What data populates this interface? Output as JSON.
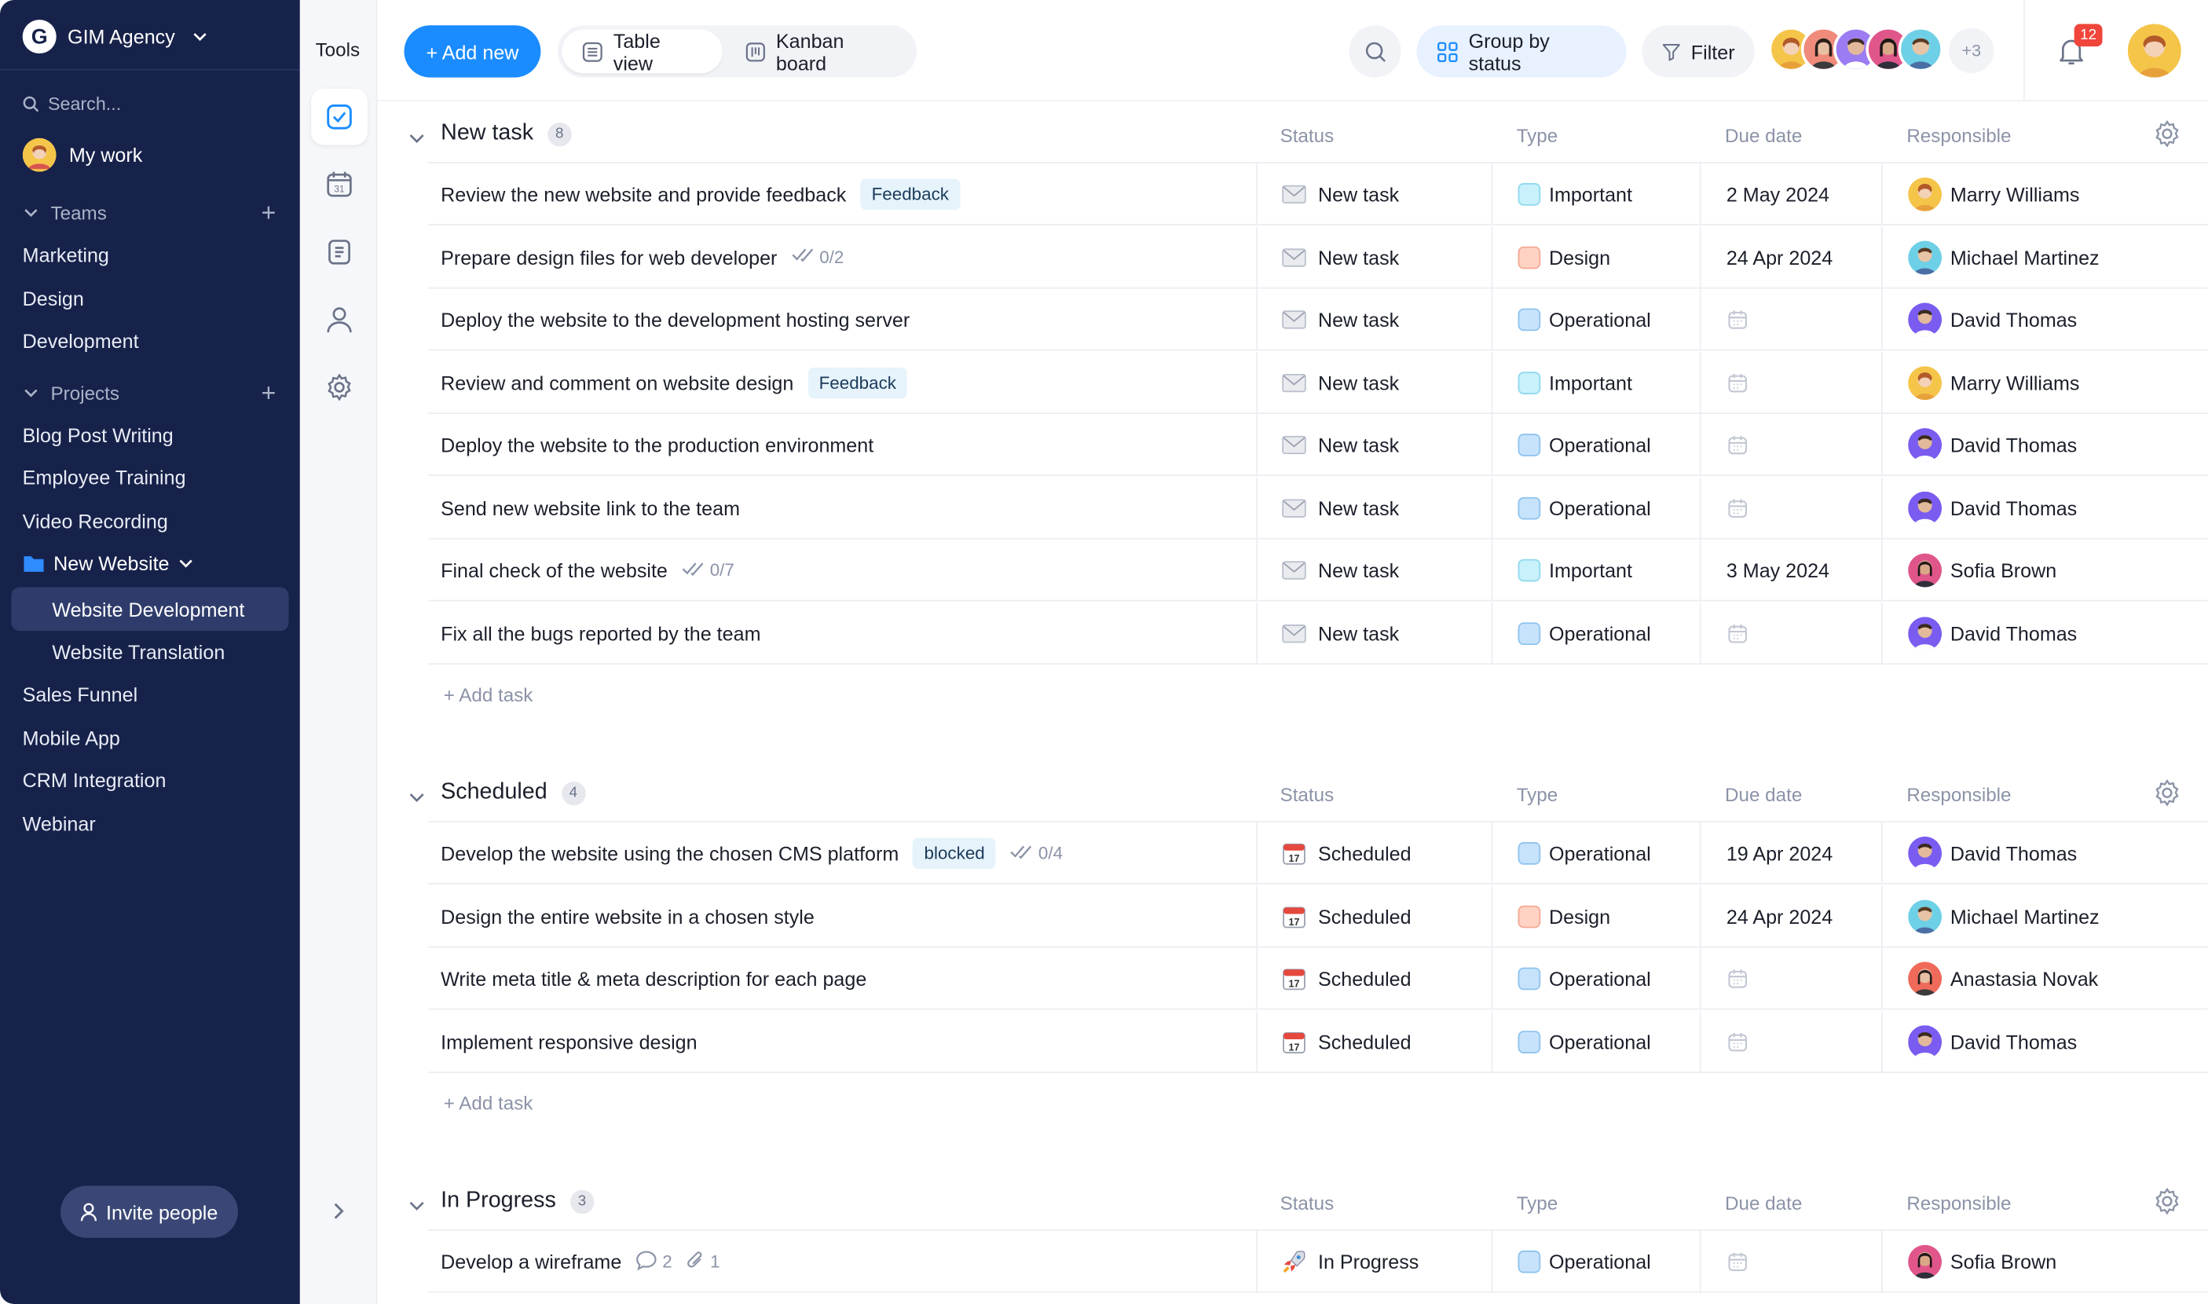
{
  "workspace": {
    "name": "GIM Agency",
    "logo_letter": "G"
  },
  "sidebar": {
    "search_placeholder": "Search...",
    "my_work": "My work",
    "teams_label": "Teams",
    "teams": [
      "Marketing",
      "Design",
      "Development"
    ],
    "projects_label": "Projects",
    "projects_top": [
      "Blog Post Writing",
      "Employee Training",
      "Video Recording"
    ],
    "folder": "New Website",
    "folder_items": [
      "Website Development",
      "Website Translation"
    ],
    "projects_bottom": [
      "Sales Funnel",
      "Mobile App",
      "CRM Integration",
      "Webinar"
    ],
    "invite_label": "Invite people"
  },
  "tools": {
    "title": "Tools"
  },
  "toolbar": {
    "add_new": "+ Add new",
    "views": [
      "Table view",
      "Kanban board"
    ],
    "group_by": "Group by status",
    "filter": "Filter",
    "more_members": "+3",
    "notifications": "12"
  },
  "columns": {
    "status": "Status",
    "type": "Type",
    "due": "Due date",
    "responsible": "Responsible"
  },
  "add_task_label": "+ Add task",
  "colors": {
    "accent": "#1a8cff",
    "sidebar": "#17224a",
    "badge": "#f0453a"
  },
  "groups": [
    {
      "title": "New task",
      "count": "8",
      "rows": [
        {
          "name": "Review the new website and provide feedback",
          "tag": "Feedback",
          "status": "New task",
          "status_icon": "envelope-icon",
          "type": "Important",
          "due": "2 May 2024",
          "resp": "Marry Williams",
          "avatar": "marry"
        },
        {
          "name": "Prepare design files for web developer",
          "sub": "0/2",
          "status": "New task",
          "status_icon": "envelope-icon",
          "type": "Design",
          "due": "24 Apr 2024",
          "resp": "Michael Martinez",
          "avatar": "michael"
        },
        {
          "name": "Deploy the website to the development hosting server",
          "status": "New task",
          "status_icon": "envelope-icon",
          "type": "Operational",
          "due": "",
          "resp": "David Thomas",
          "avatar": "david"
        },
        {
          "name": "Review and comment on website design",
          "tag": "Feedback",
          "status": "New task",
          "status_icon": "envelope-icon",
          "type": "Important",
          "due": "",
          "resp": "Marry Williams",
          "avatar": "marry"
        },
        {
          "name": "Deploy the website to the production environment",
          "status": "New task",
          "status_icon": "envelope-icon",
          "type": "Operational",
          "due": "",
          "resp": "David Thomas",
          "avatar": "david"
        },
        {
          "name": "Send new website link to the team",
          "status": "New task",
          "status_icon": "envelope-icon",
          "type": "Operational",
          "due": "",
          "resp": "David Thomas",
          "avatar": "david"
        },
        {
          "name": "Final check of the website",
          "sub": "0/7",
          "status": "New task",
          "status_icon": "envelope-icon",
          "type": "Important",
          "due": "3 May 2024",
          "resp": "Sofia Brown",
          "avatar": "sofia"
        },
        {
          "name": "Fix all the bugs reported by the team",
          "status": "New task",
          "status_icon": "envelope-icon",
          "type": "Operational",
          "due": "",
          "resp": "David Thomas",
          "avatar": "david"
        }
      ]
    },
    {
      "title": "Scheduled",
      "count": "4",
      "rows": [
        {
          "name": "Develop the website using the chosen CMS platform",
          "tag": "blocked",
          "sub": "0/4",
          "status": "Scheduled",
          "status_icon": "calendar-17-icon",
          "type": "Operational",
          "due": "19 Apr 2024",
          "resp": "David Thomas",
          "avatar": "david"
        },
        {
          "name": "Design the entire website in a chosen style",
          "status": "Scheduled",
          "status_icon": "calendar-17-icon",
          "type": "Design",
          "due": "24 Apr 2024",
          "resp": "Michael Martinez",
          "avatar": "michael"
        },
        {
          "name": "Write meta title & meta description for each page",
          "status": "Scheduled",
          "status_icon": "calendar-17-icon",
          "type": "Operational",
          "due": "",
          "resp": "Anastasia Novak",
          "avatar": "anastasia"
        },
        {
          "name": "Implement responsive design",
          "status": "Scheduled",
          "status_icon": "calendar-17-icon",
          "type": "Operational",
          "due": "",
          "resp": "David Thomas",
          "avatar": "david"
        }
      ]
    },
    {
      "title": "In Progress",
      "count": "3",
      "rows": [
        {
          "name": "Develop a wireframe",
          "comments": "2",
          "attachments": "1",
          "status": "In Progress",
          "status_icon": "rocket-icon",
          "type": "Operational",
          "due": "",
          "resp": "Sofia Brown",
          "avatar": "sofia"
        }
      ]
    }
  ]
}
